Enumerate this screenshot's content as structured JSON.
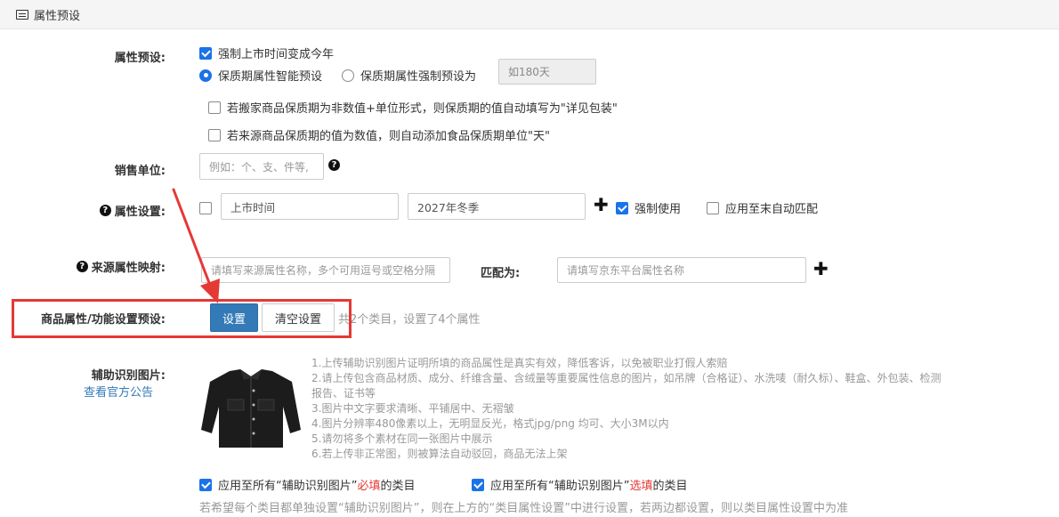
{
  "header": {
    "title": "属性预设"
  },
  "preset": {
    "label": "属性预设:",
    "force_year": "强制上市时间变成今年",
    "radio_smart": "保质期属性智能预设",
    "radio_force": "保质期属性强制预设为",
    "shelf_placeholder": "如180天",
    "opt_detail_pack": "若搬家商品保质期为非数值+单位形式，则保质期的值自动填写为\"详见包装\"",
    "opt_add_unit": "若来源商品保质期的值为数值，则自动添加食品保质期单位\"天\""
  },
  "sales_unit": {
    "label": "销售单位:",
    "placeholder": "例如：个、支、件等,"
  },
  "attr_setting": {
    "label": "属性设置:",
    "name_value": "上市时间",
    "value_value": "2027年冬季",
    "force_use": "强制使用",
    "apply_end": "应用至末自动匹配"
  },
  "source_map": {
    "label": "来源属性映射:",
    "source_placeholder": "请填写来源属性名称，多个可用逗号或空格分隔",
    "match_label": "匹配为:",
    "target_placeholder": "请填写京东平台属性名称"
  },
  "product_attr": {
    "label": "商品属性/功能设置预设:",
    "set_button": "设置",
    "clear_button": "清空设置",
    "summary": "共2个类目，设置了4个属性"
  },
  "aux_image": {
    "label": "辅助识别图片:",
    "link": "查看官方公告",
    "rules": [
      "1.上传辅助识别图片证明所填的商品属性是真实有效，降低客诉，以免被职业打假人索赔",
      "2.请上传包含商品材质、成分、纤维含量、含绒量等重要属性信息的图片，如吊牌（合格证）、水洗唛（耐久标）、鞋盒、外包装、检测",
      "报告、证书等",
      "3.图片中文字要求清晰、平铺居中、无褶皱",
      "4.图片分辨率480像素以上，无明显反光，格式jpg/png 均可、大小3M以内",
      "5.请勿将多个素材在同一张图片中展示",
      "6.若上传非正常图，则被算法自动驳回，商品无法上架"
    ],
    "apply_required_pre": "应用至所有“辅助识别图片”",
    "apply_required_red": "必填",
    "apply_required_post": "的类目",
    "apply_optional_pre": "应用至所有“辅助识别图片”",
    "apply_optional_red": "选填",
    "apply_optional_post": "的类目",
    "footer": "若希望每个类目都单独设置“辅助识别图片”，则在上方的“类目属性设置”中进行设置，若两边都设置，则以类目属性设置中为准"
  },
  "colors": {
    "primary": "#337ab7",
    "annotation_red": "#e53935",
    "checkbox_blue": "#1a73e8"
  }
}
